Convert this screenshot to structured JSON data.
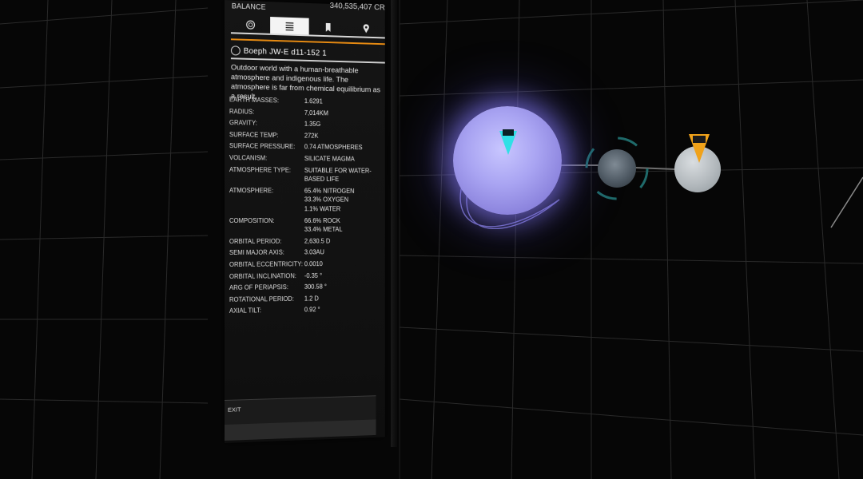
{
  "header": {
    "balance_label": "BALANCE",
    "balance_value": "340,535,407 CR"
  },
  "tabs": [
    {
      "icon": "coin-icon",
      "active": false
    },
    {
      "icon": "list-icon",
      "active": true
    },
    {
      "icon": "bookmark-icon",
      "active": false
    },
    {
      "icon": "map-pin-icon",
      "active": false
    }
  ],
  "body": {
    "name": "Boeph JW-E d11-152 1",
    "description": "Outdoor world with a human-breathable atmosphere and indigenous life. The atmosphere is far from chemical equilibrium as a result."
  },
  "stats": [
    {
      "label": "EARTH MASSES:",
      "value": "1.6291"
    },
    {
      "label": "RADIUS:",
      "value": "7,014KM"
    },
    {
      "label": "GRAVITY:",
      "value": "1.35G"
    },
    {
      "label": "SURFACE TEMP:",
      "value": "272K"
    },
    {
      "label": "SURFACE PRESSURE:",
      "value": "0.74 ATMOSPHERES"
    },
    {
      "label": "VOLCANISM:",
      "value": "SILICATE MAGMA"
    },
    {
      "label": "ATMOSPHERE TYPE:",
      "value": "SUITABLE FOR WATER-\nBASED LIFE"
    },
    {
      "label": "ATMOSPHERE:",
      "value": "65.4% NITROGEN\n33.3% OXYGEN\n1.1% WATER"
    },
    {
      "label": "COMPOSITION:",
      "value": "66.6% ROCK\n33.4% METAL"
    },
    {
      "label": "ORBITAL PERIOD:",
      "value": "2,630.5 D"
    },
    {
      "label": "SEMI MAJOR AXIS:",
      "value": "3.03AU"
    },
    {
      "label": "ORBITAL ECCENTRICITY:",
      "value": "0.0010"
    },
    {
      "label": "ORBITAL INCLINATION:",
      "value": "-0.35 °"
    },
    {
      "label": "ARG OF PERIAPSIS:",
      "value": "300.58 °"
    },
    {
      "label": "ROTATIONAL PERIOD:",
      "value": "1.2 D"
    },
    {
      "label": "AXIAL TILT:",
      "value": "0.92 °"
    }
  ],
  "footer": {
    "exit_label": "EXIT"
  },
  "colors": {
    "accent_orange": "#e68a12",
    "marker_cyan": "#2fe0e6",
    "planet_glow": "#a9a4f2"
  }
}
